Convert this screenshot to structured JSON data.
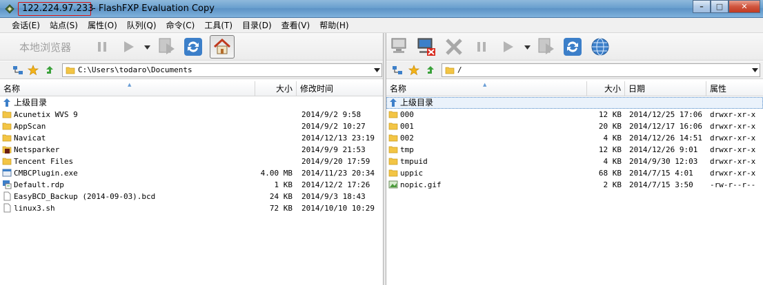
{
  "window": {
    "ip": "122.224.97.233",
    "title_rest": "- FlashFXP Evaluation Copy",
    "min_glyph": "–",
    "max_glyph": "□",
    "close_glyph": "✕"
  },
  "menu": [
    "会话(E)",
    "站点(S)",
    "属性(O)",
    "队列(Q)",
    "命令(C)",
    "工具(T)",
    "目录(D)",
    "查看(V)",
    "帮助(H)"
  ],
  "left": {
    "toolbar_label": "本地浏览器",
    "path": "C:\\Users\\todaro\\Documents",
    "columns": {
      "name": "名称",
      "size": "大小",
      "modified": "修改时间"
    },
    "up_label": "上级目录",
    "files": [
      {
        "icon": "folder-icon",
        "name": "Acunetix WVS 9",
        "size": "",
        "date": "2014/9/2 9:58"
      },
      {
        "icon": "folder-icon",
        "name": "AppScan",
        "size": "",
        "date": "2014/9/2 10:27"
      },
      {
        "icon": "folder-icon",
        "name": "Navicat",
        "size": "",
        "date": "2014/12/13 23:19"
      },
      {
        "icon": "folder-app-icon",
        "name": "Netsparker",
        "size": "",
        "date": "2014/9/9 21:53"
      },
      {
        "icon": "folder-icon",
        "name": "Tencent Files",
        "size": "",
        "date": "2014/9/20 17:59"
      },
      {
        "icon": "exe-icon",
        "name": "CMBCPlugin.exe",
        "size": "4.00 MB",
        "date": "2014/11/23 20:34"
      },
      {
        "icon": "rdp-icon",
        "name": "Default.rdp",
        "size": "1 KB",
        "date": "2014/12/2 17:26"
      },
      {
        "icon": "file-icon",
        "name": "EasyBCD_Backup (2014-09-03).bcd",
        "size": "24 KB",
        "date": "2014/9/3 18:43"
      },
      {
        "icon": "file-icon",
        "name": "linux3.sh",
        "size": "72 KB",
        "date": "2014/10/10 10:29"
      }
    ]
  },
  "right": {
    "path": "/",
    "columns": {
      "name": "名称",
      "size": "大小",
      "date": "日期",
      "attr": "属性"
    },
    "up_label": "上级目录",
    "files": [
      {
        "icon": "folder-icon",
        "name": "000",
        "size": "12 KB",
        "date": "2014/12/25 17:06",
        "attr": "drwxr-xr-x"
      },
      {
        "icon": "folder-icon",
        "name": "001",
        "size": "20 KB",
        "date": "2014/12/17 16:06",
        "attr": "drwxr-xr-x"
      },
      {
        "icon": "folder-icon",
        "name": "002",
        "size": "4 KB",
        "date": "2014/12/26 14:51",
        "attr": "drwxr-xr-x"
      },
      {
        "icon": "folder-icon",
        "name": "tmp",
        "size": "12 KB",
        "date": "2014/12/26 9:01",
        "attr": "drwxr-xr-x"
      },
      {
        "icon": "folder-icon",
        "name": "tmpuid",
        "size": "4 KB",
        "date": "2014/9/30 12:03",
        "attr": "drwxr-xr-x"
      },
      {
        "icon": "folder-icon",
        "name": "uppic",
        "size": "68 KB",
        "date": "2014/7/15 4:01",
        "attr": "drwxr-xr-x"
      },
      {
        "icon": "image-icon",
        "name": "nopic.gif",
        "size": "2 KB",
        "date": "2014/7/15 3:50",
        "attr": "-rw-r--r--"
      }
    ]
  },
  "colors": {
    "folder": "#f3c545",
    "accent_blue": "#3c7fc9",
    "close_red": "#c8412a"
  }
}
